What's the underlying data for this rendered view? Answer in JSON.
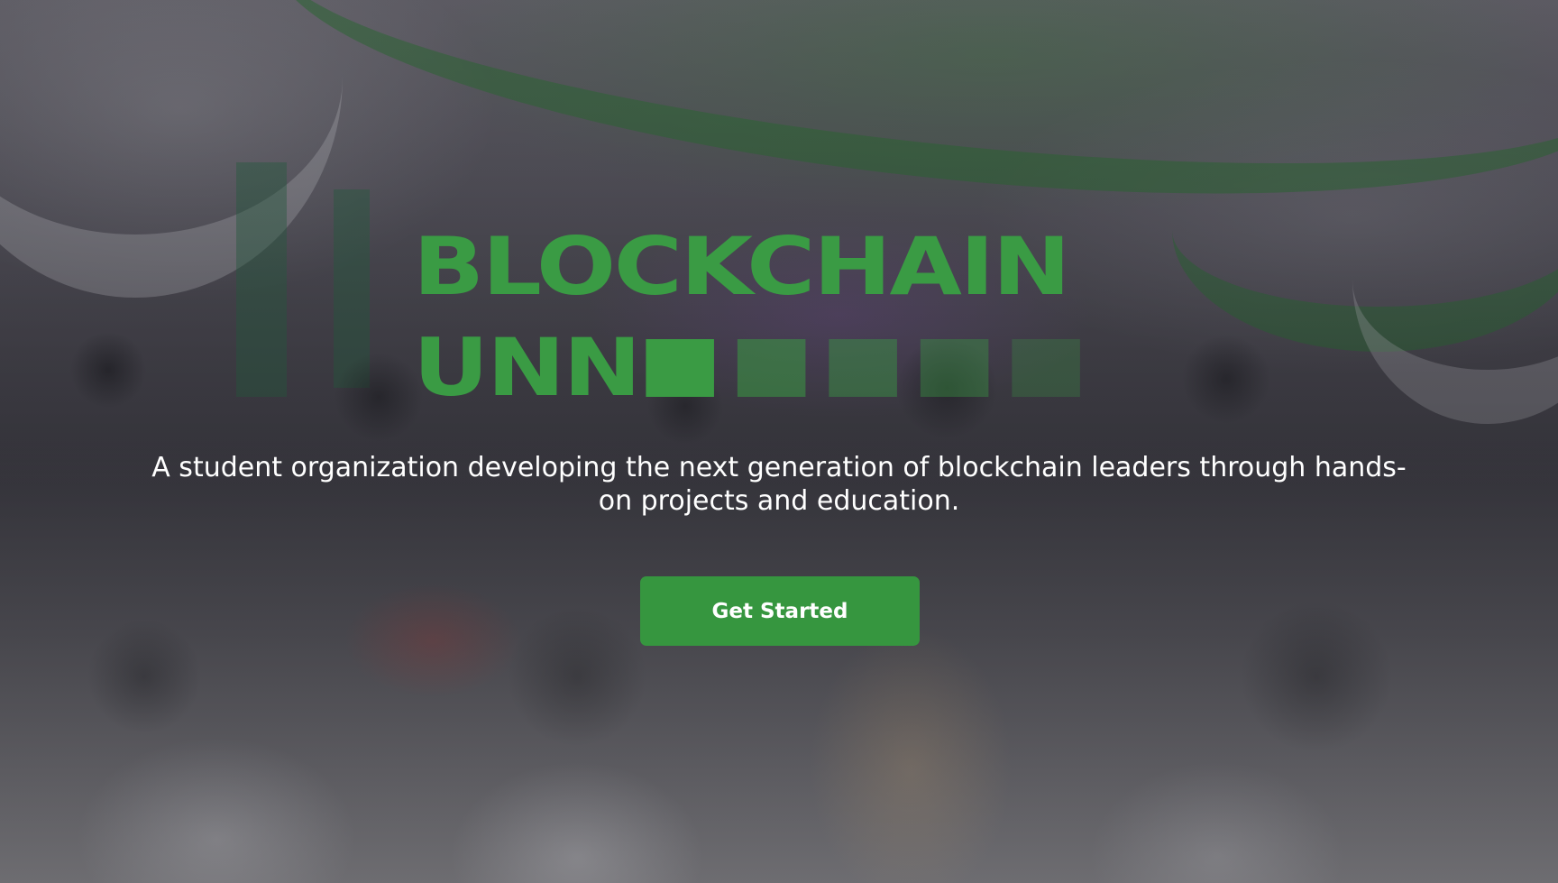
{
  "hero": {
    "title_line1": "BLOCKCHAIN",
    "title_line2": "UNN",
    "subtitle": "A student organization developing the next generation of blockchain leaders through hands-on projects and education.",
    "cta_label": "Get Started"
  },
  "colors": {
    "accent": "#3a9b44",
    "button": "#36963f",
    "text": "#ffffff"
  }
}
